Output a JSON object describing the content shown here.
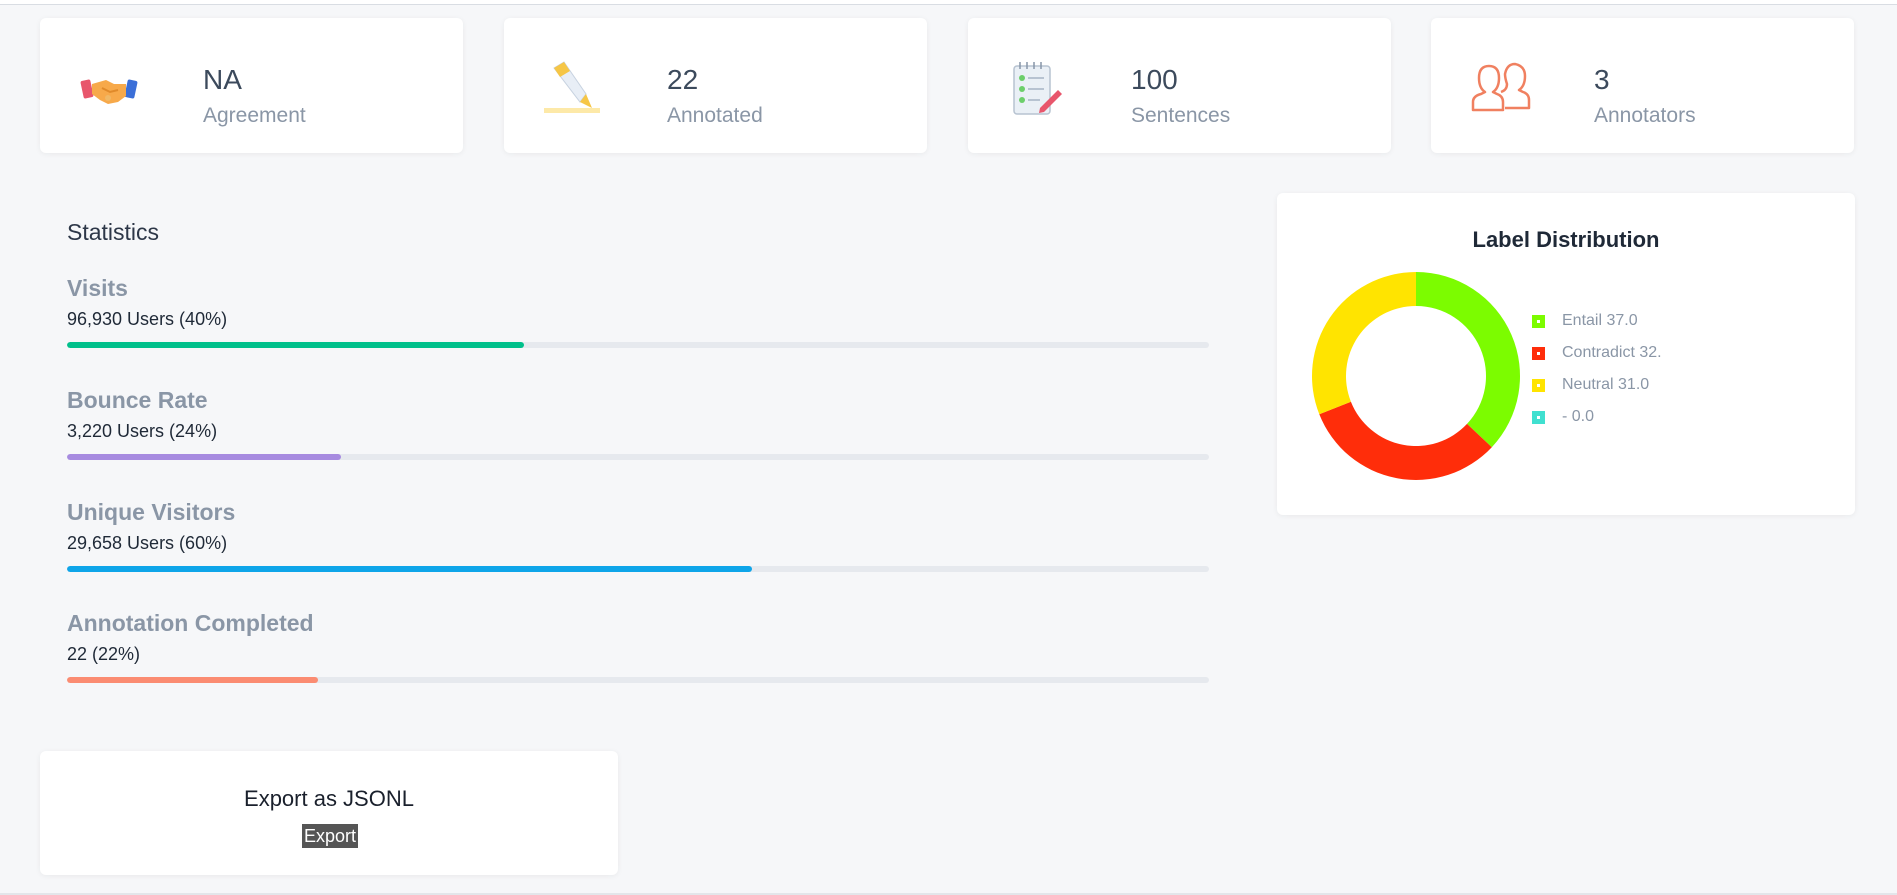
{
  "summary_cards": [
    {
      "value": "NA",
      "label": "Agreement",
      "icon": "handshake-icon"
    },
    {
      "value": "22",
      "label": "Annotated",
      "icon": "highlighter-icon"
    },
    {
      "value": "100",
      "label": "Sentences",
      "icon": "checklist-notepad-icon"
    },
    {
      "value": "3",
      "label": "Annotators",
      "icon": "users-icon"
    }
  ],
  "statistics": {
    "title": "Statistics",
    "metrics": [
      {
        "name": "Visits",
        "detail": "96,930 Users (40%)",
        "percent": 40,
        "color": "#00c08b"
      },
      {
        "name": "Bounce Rate",
        "detail": "3,220 Users (24%)",
        "percent": 24,
        "color": "#a78be0"
      },
      {
        "name": "Unique Visitors",
        "detail": "29,658 Users (60%)",
        "percent": 60,
        "color": "#0ea5e9"
      },
      {
        "name": "Annotation Completed",
        "detail": "22 (22%)",
        "percent": 22,
        "color": "#fb8c72"
      }
    ]
  },
  "label_distribution": {
    "title": "Label Distribution",
    "legend": [
      {
        "label": "Entail 37.0",
        "color": "#7cfc00"
      },
      {
        "label": "Contradict 32.",
        "color": "#ff2d0a"
      },
      {
        "label": "Neutral 31.0",
        "color": "#ffe400"
      },
      {
        "label": "- 0.0",
        "color": "#40e0d0"
      }
    ]
  },
  "chart_data": {
    "type": "pie",
    "title": "Label Distribution",
    "categories": [
      "Entail",
      "Contradict",
      "Neutral",
      "-"
    ],
    "values": [
      37.0,
      32.0,
      31.0,
      0.0
    ],
    "colors": [
      "#7cfc00",
      "#ff2d0a",
      "#ffe400",
      "#40e0d0"
    ],
    "donut": true,
    "legend_position": "right"
  },
  "export": {
    "title": "Export as JSONL",
    "button_label": "Export"
  }
}
